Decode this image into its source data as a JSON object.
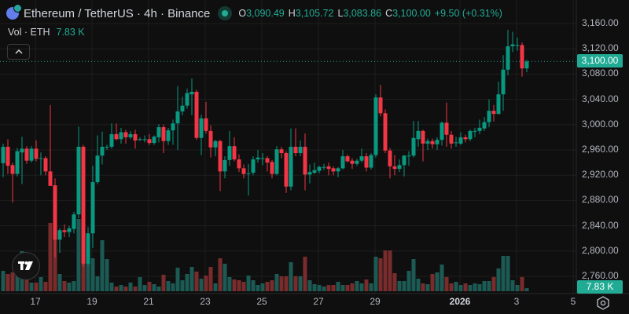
{
  "header": {
    "symbol_title": "Ethereum / TetherUS · 4h · Binance",
    "open_label": "O",
    "open": "3,090.49",
    "high_label": "H",
    "high": "3,105.72",
    "low_label": "L",
    "low": "3,083.86",
    "close_label": "C",
    "close": "3,100.00",
    "change": "+9.50 (+0.31%)",
    "icon": "ethereum-icon",
    "status_icon": "market-open-dot-icon"
  },
  "volume_legend": {
    "label": "Vol · ETH",
    "value": "7.83 K"
  },
  "collapse_icon": "chevron-up-icon",
  "last_price_label": "3,100.00",
  "last_volume_label": "7.83 K",
  "colors": {
    "up": "#089981",
    "down": "#f23645",
    "up_volume": "#1c5a54",
    "down_volume": "#7a2c2c",
    "background": "#0f0f0f",
    "grid": "#1e1e1e"
  },
  "chart_data": {
    "type": "candlestick",
    "title": "Ethereum / TetherUS · 4h · Binance",
    "interval": "4h",
    "y_ticks": [
      "3,160.00",
      "3,120.00",
      "3,080.00",
      "3,040.00",
      "3,000.00",
      "2,960.00",
      "2,920.00",
      "2,880.00",
      "2,840.00",
      "2,800.00",
      "2,760.00"
    ],
    "y_tick_values": [
      3160,
      3120,
      3080,
      3040,
      3000,
      2960,
      2920,
      2880,
      2840,
      2800,
      2760
    ],
    "x_ticks": [
      {
        "label": "17",
        "index": 7
      },
      {
        "label": "19",
        "index": 19
      },
      {
        "label": "21",
        "index": 31
      },
      {
        "label": "23",
        "index": 43
      },
      {
        "label": "25",
        "index": 55
      },
      {
        "label": "27",
        "index": 67
      },
      {
        "label": "29",
        "index": 79
      },
      {
        "label": "2026",
        "index": 97,
        "bold": true
      },
      {
        "label": "3",
        "index": 109
      },
      {
        "label": "5",
        "index": 121
      }
    ],
    "ylim": [
      2740,
      3175
    ],
    "grid": true,
    "last_price": 3100.0,
    "ohlc": [
      [
        2939,
        2970,
        2917,
        2965
      ],
      [
        2965,
        2977,
        2922,
        2935
      ],
      [
        2936,
        2940,
        2877,
        2922
      ],
      [
        2922,
        2963,
        2918,
        2958
      ],
      [
        2956,
        2981,
        2906,
        2962
      ],
      [
        2962,
        2966,
        2938,
        2943
      ],
      [
        2943,
        2966,
        2940,
        2962
      ],
      [
        2962,
        2975,
        2942,
        2946
      ],
      [
        2947,
        2956,
        2920,
        2947
      ],
      [
        2947,
        2950,
        2920,
        2926
      ],
      [
        2926,
        3031,
        2906,
        2903
      ],
      [
        2904,
        2915,
        2790,
        2818
      ],
      [
        2818,
        2836,
        2797,
        2833
      ],
      [
        2833,
        2842,
        2822,
        2830
      ],
      [
        2830,
        2840,
        2822,
        2836
      ],
      [
        2835,
        2862,
        2828,
        2858
      ],
      [
        2858,
        2997,
        2852,
        2965
      ],
      [
        2965,
        2968,
        2775,
        2780
      ],
      [
        2780,
        2838,
        2778,
        2828
      ],
      [
        2828,
        2935,
        2805,
        2909
      ],
      [
        2909,
        2983,
        2906,
        2951
      ],
      [
        2951,
        2989,
        2937,
        2965
      ],
      [
        2965,
        2968,
        2960,
        2965
      ],
      [
        2965,
        3002,
        2962,
        2985
      ],
      [
        2985,
        3002,
        2975,
        2977
      ],
      [
        2977,
        2995,
        2970,
        2988
      ],
      [
        2988,
        2992,
        2970,
        2980
      ],
      [
        2980,
        2990,
        2977,
        2985
      ],
      [
        2985,
        2992,
        2962,
        2975
      ],
      [
        2976,
        2980,
        2974,
        2977
      ],
      [
        2977,
        2983,
        2972,
        2977
      ],
      [
        2977,
        2985,
        2968,
        2971
      ],
      [
        2971,
        2983,
        2968,
        2981
      ],
      [
        2980,
        3001,
        2972,
        2996
      ],
      [
        2996,
        3000,
        2955,
        2974
      ],
      [
        2974,
        2995,
        2968,
        2991
      ],
      [
        2991,
        3008,
        2968,
        3002
      ],
      [
        3002,
        3061,
        2960,
        3021
      ],
      [
        3021,
        3044,
        3015,
        3030
      ],
      [
        3030,
        3057,
        3025,
        3050
      ],
      [
        3048,
        3073,
        3015,
        3052
      ],
      [
        3052,
        3055,
        2976,
        2979
      ],
      [
        2979,
        3016,
        2952,
        3010
      ],
      [
        3010,
        3036,
        2986,
        2990
      ],
      [
        2990,
        2999,
        2948,
        2964
      ],
      [
        2964,
        2976,
        2950,
        2974
      ],
      [
        2974,
        2976,
        2895,
        2926
      ],
      [
        2926,
        2950,
        2915,
        2944
      ],
      [
        2944,
        2990,
        2935,
        2966
      ],
      [
        2966,
        2980,
        2942,
        2945
      ],
      [
        2945,
        2953,
        2925,
        2931
      ],
      [
        2931,
        2937,
        2915,
        2922
      ],
      [
        2922,
        2938,
        2888,
        2923
      ],
      [
        2924,
        2950,
        2920,
        2945
      ],
      [
        2945,
        2960,
        2940,
        2948
      ],
      [
        2947,
        2955,
        2936,
        2947
      ],
      [
        2947,
        2950,
        2926,
        2940
      ],
      [
        2941,
        2944,
        2915,
        2922
      ],
      [
        2922,
        2966,
        2920,
        2961
      ],
      [
        2961,
        2965,
        2947,
        2955
      ],
      [
        2955,
        2958,
        2892,
        2902
      ],
      [
        2902,
        2994,
        2896,
        2965
      ],
      [
        2965,
        2994,
        2950,
        2955
      ],
      [
        2955,
        2975,
        2950,
        2965
      ],
      [
        2965,
        2986,
        2896,
        2921
      ],
      [
        2921,
        2937,
        2907,
        2925
      ],
      [
        2924,
        2940,
        2922,
        2928
      ],
      [
        2927,
        2935,
        2923,
        2933
      ],
      [
        2933,
        2938,
        2928,
        2933
      ],
      [
        2934,
        2940,
        2920,
        2930
      ],
      [
        2931,
        2934,
        2920,
        2926
      ],
      [
        2926,
        2933,
        2917,
        2931
      ],
      [
        2931,
        2960,
        2929,
        2950
      ],
      [
        2950,
        2953,
        2940,
        2942
      ],
      [
        2943,
        2947,
        2930,
        2938
      ],
      [
        2938,
        2946,
        2935,
        2943
      ],
      [
        2943,
        2962,
        2940,
        2950
      ],
      [
        2950,
        2955,
        2926,
        2932
      ],
      [
        2932,
        2955,
        2929,
        2952
      ],
      [
        2952,
        3048,
        2948,
        3043
      ],
      [
        3043,
        3063,
        3013,
        3018
      ],
      [
        3018,
        3024,
        2955,
        2959
      ],
      [
        2959,
        2963,
        2915,
        2934
      ],
      [
        2934,
        2952,
        2920,
        2930
      ],
      [
        2930,
        2945,
        2925,
        2936
      ],
      [
        2936,
        2952,
        2918,
        2951
      ],
      [
        2951,
        2958,
        2935,
        2951
      ],
      [
        2951,
        3006,
        2948,
        2979
      ],
      [
        2977,
        3006,
        2965,
        2990
      ],
      [
        2990,
        2992,
        2942,
        2970
      ],
      [
        2970,
        2978,
        2960,
        2974
      ],
      [
        2974,
        2978,
        2962,
        2969
      ],
      [
        2969,
        2980,
        2960,
        2976
      ],
      [
        2976,
        3005,
        2967,
        3003
      ],
      [
        3003,
        3035,
        2965,
        2984
      ],
      [
        2984,
        2990,
        2962,
        2970
      ],
      [
        2971,
        2981,
        2965,
        2972
      ],
      [
        2970,
        2988,
        2968,
        2980
      ],
      [
        2980,
        2984,
        2972,
        2977
      ],
      [
        2977,
        2992,
        2974,
        2990
      ],
      [
        2990,
        2995,
        2980,
        2990
      ],
      [
        2990,
        3008,
        2985,
        2995
      ],
      [
        2994,
        3012,
        2990,
        3004
      ],
      [
        3004,
        3040,
        2996,
        3022
      ],
      [
        3022,
        3031,
        3005,
        3017
      ],
      [
        3017,
        3068,
        3016,
        3048
      ],
      [
        3048,
        3110,
        3022,
        3087
      ],
      [
        3087,
        3150,
        3078,
        3124
      ],
      [
        3124,
        3147,
        3115,
        3127
      ],
      [
        3126,
        3138,
        3117,
        3126
      ],
      [
        3126,
        3130,
        3076,
        3089
      ],
      [
        3089,
        3103,
        3083,
        3100
      ]
    ],
    "volume_k": [
      52,
      44,
      48,
      46,
      102,
      32,
      22,
      22,
      36,
      24,
      174,
      150,
      44,
      26,
      22,
      26,
      184,
      124,
      108,
      84,
      38,
      130,
      82,
      22,
      12,
      16,
      12,
      22,
      12,
      36,
      16,
      24,
      18,
      12,
      42,
      26,
      20,
      60,
      28,
      44,
      62,
      50,
      32,
      40,
      62,
      20,
      84,
      70,
      36,
      30,
      28,
      24,
      40,
      28,
      16,
      20,
      24,
      28,
      44,
      38,
      38,
      74,
      38,
      38,
      88,
      28,
      18,
      16,
      12,
      16,
      16,
      24,
      16,
      16,
      20,
      26,
      20,
      30,
      20,
      88,
      84,
      104,
      104,
      46,
      26,
      26,
      52,
      82,
      32,
      20,
      18,
      44,
      48,
      68,
      36,
      20,
      24,
      16,
      20,
      16,
      20,
      18,
      26,
      26,
      36,
      58,
      90,
      90,
      28,
      16,
      36,
      7.83
    ]
  }
}
